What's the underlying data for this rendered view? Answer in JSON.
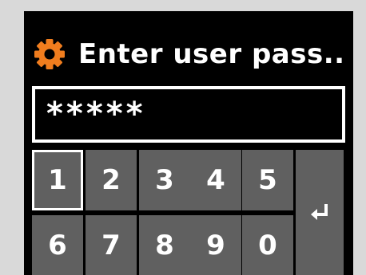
{
  "header": {
    "title": "Enter user pass..",
    "icon": "gear-icon",
    "icon_color": "#f07d1e"
  },
  "password": {
    "value": "*****"
  },
  "keypad": {
    "keys": [
      "1",
      "2",
      "3",
      "4",
      "5",
      "6",
      "7",
      "8",
      "9",
      "0"
    ],
    "selected": "1",
    "enter_icon": "enter-return-icon"
  },
  "colors": {
    "background": "#000000",
    "key": "#606060",
    "text": "#ffffff",
    "frame": "#d9d9d9"
  }
}
